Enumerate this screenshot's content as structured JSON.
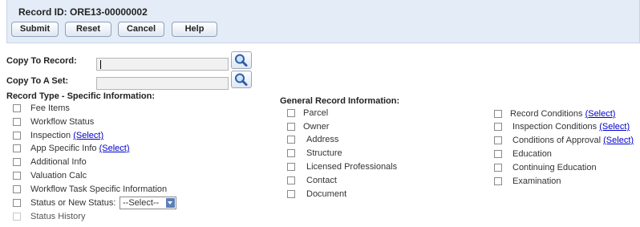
{
  "header": {
    "record_id": "Record ID: ORE13-00000002",
    "buttons": {
      "submit": "Submit",
      "reset": "Reset",
      "cancel": "Cancel",
      "help": "Help"
    }
  },
  "copy_to_record": {
    "label": "Copy To Record:",
    "value": ""
  },
  "copy_to_set": {
    "label": "Copy To A Set:",
    "value": ""
  },
  "record_type": {
    "title": "Record Type - Specific Information:",
    "items": {
      "fee_items": "Fee Items",
      "workflow_status": "Workflow Status",
      "inspection": "Inspection",
      "app_specific_info": "App Specific Info",
      "additional_info": "Additional Info",
      "valuation_calc": "Valuation Calc",
      "workflow_task_specific": "Workflow Task Specific Information",
      "status_or_new_status": "Status or New Status:",
      "status_history": "Status History"
    },
    "status_select_value": "--Select--"
  },
  "general": {
    "title": "General Record Information:",
    "items": {
      "parcel": "Parcel",
      "owner": "Owner",
      "address": "Address",
      "structure": "Structure",
      "licensed_professionals": "Licensed Professionals",
      "contact": "Contact",
      "document": "Document"
    }
  },
  "conditions": {
    "items": {
      "record_conditions": "Record Conditions",
      "inspection_conditions": "Inspection Conditions",
      "conditions_of_approval": "Conditions of Approval",
      "education": "Education",
      "continuing_education": "Continuing Education",
      "examination": "Examination"
    }
  },
  "select_link": "(Select)"
}
